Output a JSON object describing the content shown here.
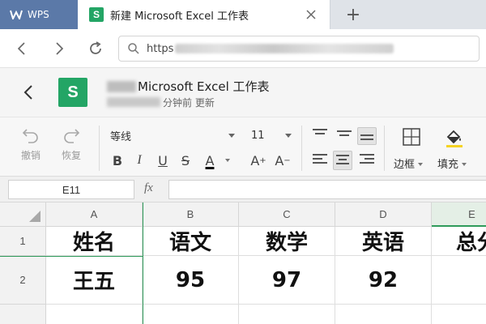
{
  "tabs": {
    "wps_label": "WPS",
    "active_label": "新建 Microsoft Excel 工作表",
    "new_tab": "+"
  },
  "nav": {
    "url_prefix": "https"
  },
  "document": {
    "title": "Microsoft Excel 工作表",
    "subtitle": "分钟前 更新",
    "icon_letter": "S"
  },
  "ribbon": {
    "undo_label": "撤销",
    "redo_label": "恢复",
    "font_name": "等线",
    "font_size": "11",
    "bold": "B",
    "italic": "I",
    "underline": "U",
    "strike": "S",
    "font_color": "A",
    "grow_font": "A",
    "shrink_font": "A",
    "border_label": "边框",
    "fill_label": "填充"
  },
  "formula_bar": {
    "cell_ref": "E11",
    "fx": "fx",
    "value": ""
  },
  "sheet": {
    "columns": [
      "A",
      "B",
      "C",
      "D",
      "E"
    ],
    "rows": [
      "1",
      "2"
    ],
    "header_row": [
      "姓名",
      "语文",
      "数学",
      "英语",
      "总分"
    ],
    "data_row": [
      "王五",
      "95",
      "97",
      "92",
      ""
    ]
  },
  "colors": {
    "wps_blue": "#5b79a8",
    "excel_green": "#23a565",
    "selection_green": "#2f9b5b",
    "fill_yellow": "#f5d322"
  }
}
